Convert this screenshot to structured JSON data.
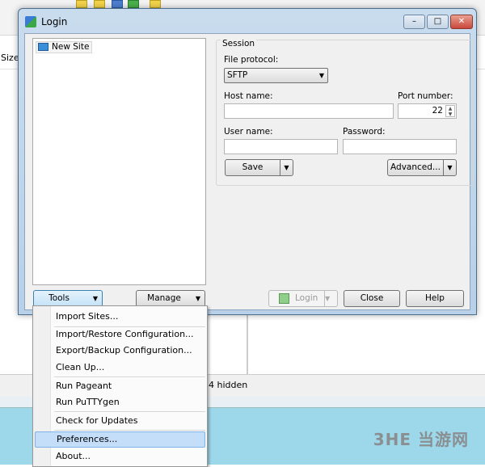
{
  "background": {
    "column_size": "Size",
    "status_text": "4 hidden",
    "watermark": "3HE 当游网"
  },
  "dialog": {
    "title": "Login",
    "minimize": "–",
    "maximize": "□",
    "close": "✕",
    "site_tree": {
      "items": [
        {
          "label": "New Site",
          "icon": "monitor-icon"
        }
      ]
    },
    "session": {
      "group_label": "Session",
      "file_protocol_label": "File protocol:",
      "file_protocol_value": "SFTP",
      "host_label": "Host name:",
      "host_value": "",
      "port_label": "Port number:",
      "port_value": "22",
      "user_label": "User name:",
      "user_value": "",
      "password_label": "Password:",
      "password_value": "",
      "save_button": "Save",
      "advanced_button": "Advanced..."
    },
    "buttons": {
      "tools": "Tools",
      "manage": "Manage",
      "login": "Login",
      "close": "Close",
      "help": "Help"
    }
  },
  "tools_menu": {
    "items": [
      "Import Sites...",
      "Import/Restore Configuration...",
      "Export/Backup Configuration...",
      "Clean Up...",
      "Run Pageant",
      "Run PuTTYgen",
      "Check for Updates",
      "Preferences...",
      "About..."
    ],
    "highlighted": "Preferences..."
  },
  "colors": {
    "accent": "#c4defa",
    "taskbar": "#9dd8ea",
    "titlebar": "#c9dcee",
    "close_button": "#d9574a"
  }
}
